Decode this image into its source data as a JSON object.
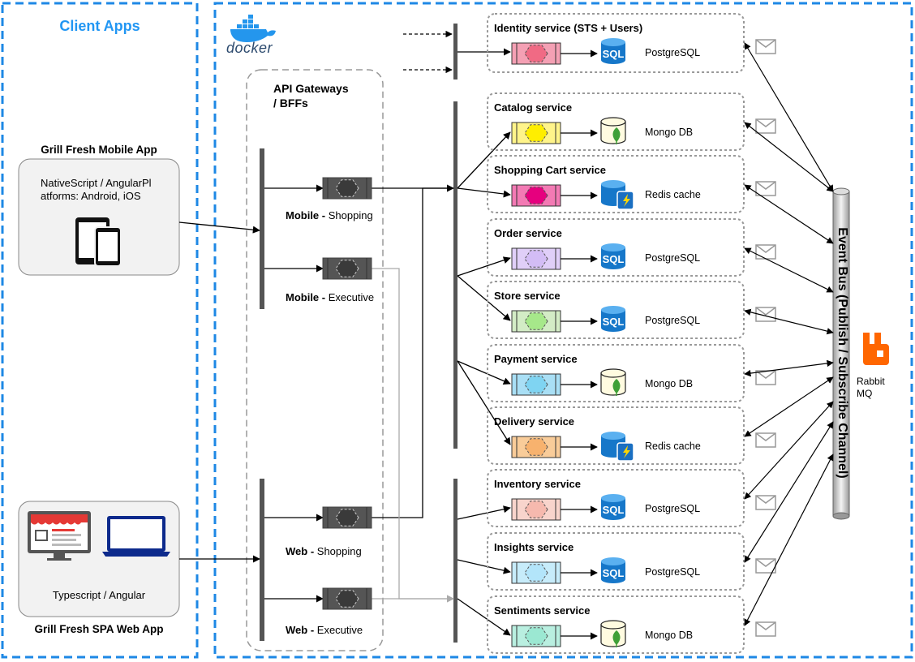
{
  "client_apps_title": "Client Apps",
  "docker_label": "docker",
  "gateways_title": "API Gateways\n/ BFFs",
  "mobile_app": {
    "title": "Grill Fresh Mobile App",
    "desc": "NativeScript / AngularPl\natforms: Android, iOS"
  },
  "web_app": {
    "title": "Grill Fresh SPA Web App",
    "desc": "Typescript / Angular"
  },
  "gateways": [
    {
      "bold": "Mobile -",
      "rest": "Shopping"
    },
    {
      "bold": "Mobile -",
      "rest": "Executive"
    },
    {
      "bold": "Web -",
      "rest": "Shopping"
    },
    {
      "bold": "Web -",
      "rest": "Executive"
    }
  ],
  "services": [
    {
      "name": "Identity service (STS + Users)",
      "db": "PostgreSQL",
      "db_type": "sql",
      "color": "#f4a0b4",
      "hex": "#f06a84"
    },
    {
      "name": "Catalog service",
      "db": "Mongo DB",
      "db_type": "mongo",
      "color": "#fff48a",
      "hex": "#ffee00"
    },
    {
      "name": "Shopping Cart service",
      "db": "Redis cache",
      "db_type": "redis",
      "color": "#f37ab4",
      "hex": "#e6007e"
    },
    {
      "name": "Order service",
      "db": "PostgreSQL",
      "db_type": "sql",
      "color": "#e0cff8",
      "hex": "#d3bdf5"
    },
    {
      "name": "Store service",
      "db": "PostgreSQL",
      "db_type": "sql",
      "color": "#d3ecc6",
      "hex": "#a6e88a"
    },
    {
      "name": "Payment service",
      "db": "Mongo DB",
      "db_type": "mongo",
      "color": "#a9dff5",
      "hex": "#7fd4f2"
    },
    {
      "name": "Delivery service",
      "db": "Redis cache",
      "db_type": "redis",
      "color": "#f9cc99",
      "hex": "#f7b26e"
    },
    {
      "name": "Inventory service",
      "db": "PostgreSQL",
      "db_type": "sql",
      "color": "#f8d4cc",
      "hex": "#f6b9ae"
    },
    {
      "name": "Insights service",
      "db": "PostgreSQL",
      "db_type": "sql",
      "color": "#c7ecfa",
      "hex": "#b3e5fa"
    },
    {
      "name": "Sentiments service",
      "db": "Mongo DB",
      "db_type": "mongo",
      "color": "#b9efe0",
      "hex": "#9be8d2"
    }
  ],
  "event_bus_label": "Event Bus (Publish / Subscribe Channel)",
  "rabbit_label": "Rabbit\nMQ",
  "colors": {
    "border_blue": "#1e88e5",
    "title_blue": "#2196f3",
    "dotted_gray": "#9e9e9e",
    "bar_gray": "#555555",
    "rabbit_orange": "#ff6600",
    "sql_blue": "#1677c9"
  }
}
